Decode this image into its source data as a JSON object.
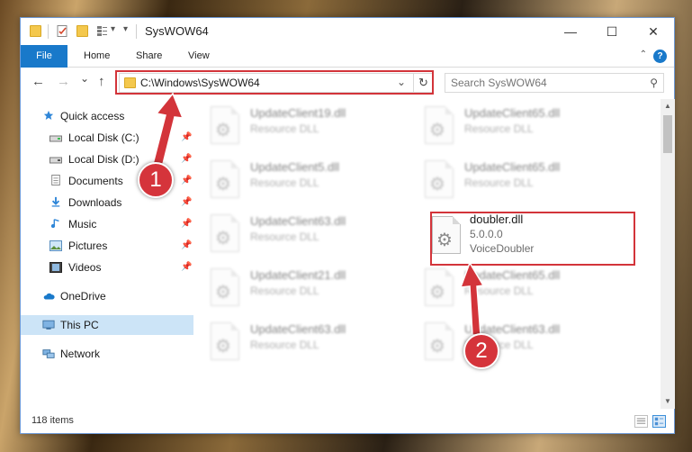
{
  "window": {
    "title": "SysWOW64"
  },
  "window_controls": {
    "minimize": "—",
    "maximize": "☐",
    "close": "✕"
  },
  "ribbon": {
    "file": "File",
    "home": "Home",
    "share": "Share",
    "view": "View",
    "help": "?",
    "collapse": "⌃"
  },
  "nav": {
    "back": "←",
    "forward": "→",
    "recent": "⌄",
    "up": "↑"
  },
  "address": {
    "path": "C:\\Windows\\SysWOW64",
    "dropdown": "⌄",
    "refresh": "↻"
  },
  "search": {
    "placeholder": "Search SysWOW64",
    "icon": "⚲"
  },
  "sidebar": {
    "quick_access": "Quick access",
    "local_c": "Local Disk (C:)",
    "local_d": "Local Disk (D:)",
    "documents": "Documents",
    "downloads": "Downloads",
    "music": "Music",
    "pictures": "Pictures",
    "videos": "Videos",
    "onedrive": "OneDrive",
    "this_pc": "This PC",
    "network": "Network",
    "pin": "📌"
  },
  "files": [
    {
      "name": "UpdateClient19.dll",
      "line1": "Resource DLL",
      "line2": ""
    },
    {
      "name": "UpdateClient65.dll",
      "line1": "Resource DLL",
      "line2": ""
    },
    {
      "name": "UpdateClient5.dll",
      "line1": "Resource DLL",
      "line2": ""
    },
    {
      "name": "UpdateClient65.dll",
      "line1": "Resource DLL",
      "line2": ""
    },
    {
      "name": "UpdateClient63.dll",
      "line1": "Resource DLL",
      "line2": ""
    },
    {
      "name": "doubler.dll",
      "line1": "5.0.0.0",
      "line2": "VoiceDoubler"
    },
    {
      "name": "UpdateClient21.dll",
      "line1": "Resource DLL",
      "line2": ""
    },
    {
      "name": "UpdateClient65.dll",
      "line1": "Resource DLL",
      "line2": ""
    },
    {
      "name": "UpdateClient63.dll",
      "line1": "Resource DLL",
      "line2": ""
    },
    {
      "name": "UpdateClient63.dll",
      "line1": "Resource DLL",
      "line2": ""
    }
  ],
  "gear_glyph": "⚙",
  "scroll": {
    "up": "▲",
    "down": "▼"
  },
  "status": {
    "items": "118 items"
  },
  "annotations": {
    "marker1": "1",
    "marker2": "2",
    "color": "#d3343a"
  },
  "colors": {
    "accent": "#1979ca",
    "selection": "#cce4f7"
  }
}
